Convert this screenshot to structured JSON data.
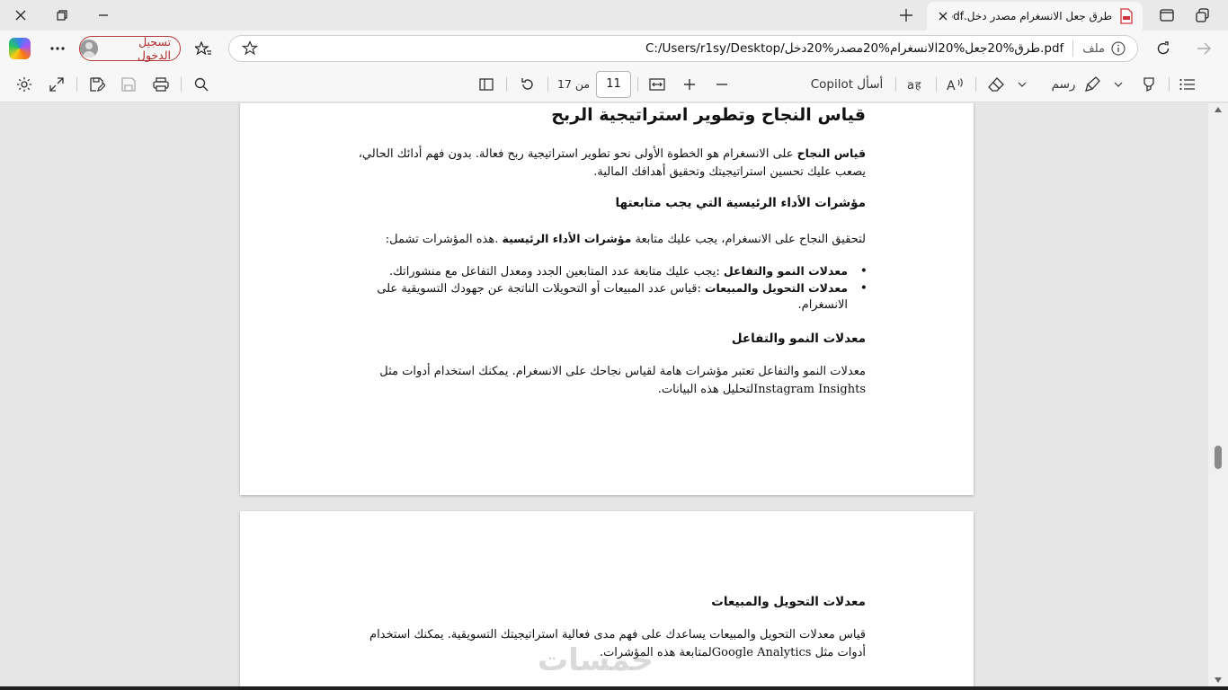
{
  "window": {
    "tab_title": "طرق جعل الانسغرام مصدر دخل.pdf"
  },
  "addressbar": {
    "file_label": "ملف",
    "url": "C:/Users/r1sy/Desktop/طرق%20جعل%20الانسغرام%20مصدر%20دخل.pdf",
    "signin_label": "تسجيل الدخول"
  },
  "pdf_toolbar": {
    "current_page": "11",
    "total_pages_text": "من 17",
    "draw_label": "رسم",
    "ask_copilot_label": "أسأل Copilot"
  },
  "document": {
    "page1": {
      "heading": "قياس النجاح وتطوير استراتيجية الربح",
      "intro_bold": "قياس النجاح",
      "intro_rest": " على الانسغرام هو الخطوة الأولى نحو تطوير استراتيجية ربح فعالة. بدون فهم أدائك الحالي، يصعب عليك تحسين استراتيجيتك وتحقيق أهدافك المالية.",
      "kpi_heading": "مؤشرات الأداء الرئيسية التي يجب متابعتها",
      "kpi_intro_pre": "لتحقيق النجاح على الانسغرام، يجب عليك متابعة ",
      "kpi_intro_bold": "مؤشرات الأداء الرئيسية",
      "kpi_intro_post": " .هذه المؤشرات تشمل:",
      "bullets": [
        {
          "bold": "معدلات النمو والتفاعل",
          "text": " :يجب عليك متابعة عدد المتابعين الجدد ومعدل التفاعل مع منشوراتك."
        },
        {
          "bold": "معدلات التحويل والمبيعات",
          "text": " :قياس عدد المبيعات أو التحويلات الناتجة عن جهودك التسويقية على الانسغرام."
        }
      ],
      "growth_heading": "معدلات النمو والتفاعل",
      "growth_text": "معدلات النمو والتفاعل تعتبر مؤشرات هامة لقياس نجاحك على الانسغرام. يمكنك استخدام أدوات مثل Instagram Insightsلتحليل هذه البيانات."
    },
    "page2": {
      "conv_heading": "معدلات التحويل والمبيعات",
      "conv_text": "قياس معدلات التحويل والمبيعات يساعدك على فهم مدى فعالية استراتيجيتك التسويقية. يمكنك استخدام أدوات مثل Google Analyticsلمتابعة هذه المؤشرات."
    }
  },
  "watermark": "خمسات",
  "colors": {
    "signin_accent": "#b02a2a",
    "pdf_icon": "#d13438"
  }
}
